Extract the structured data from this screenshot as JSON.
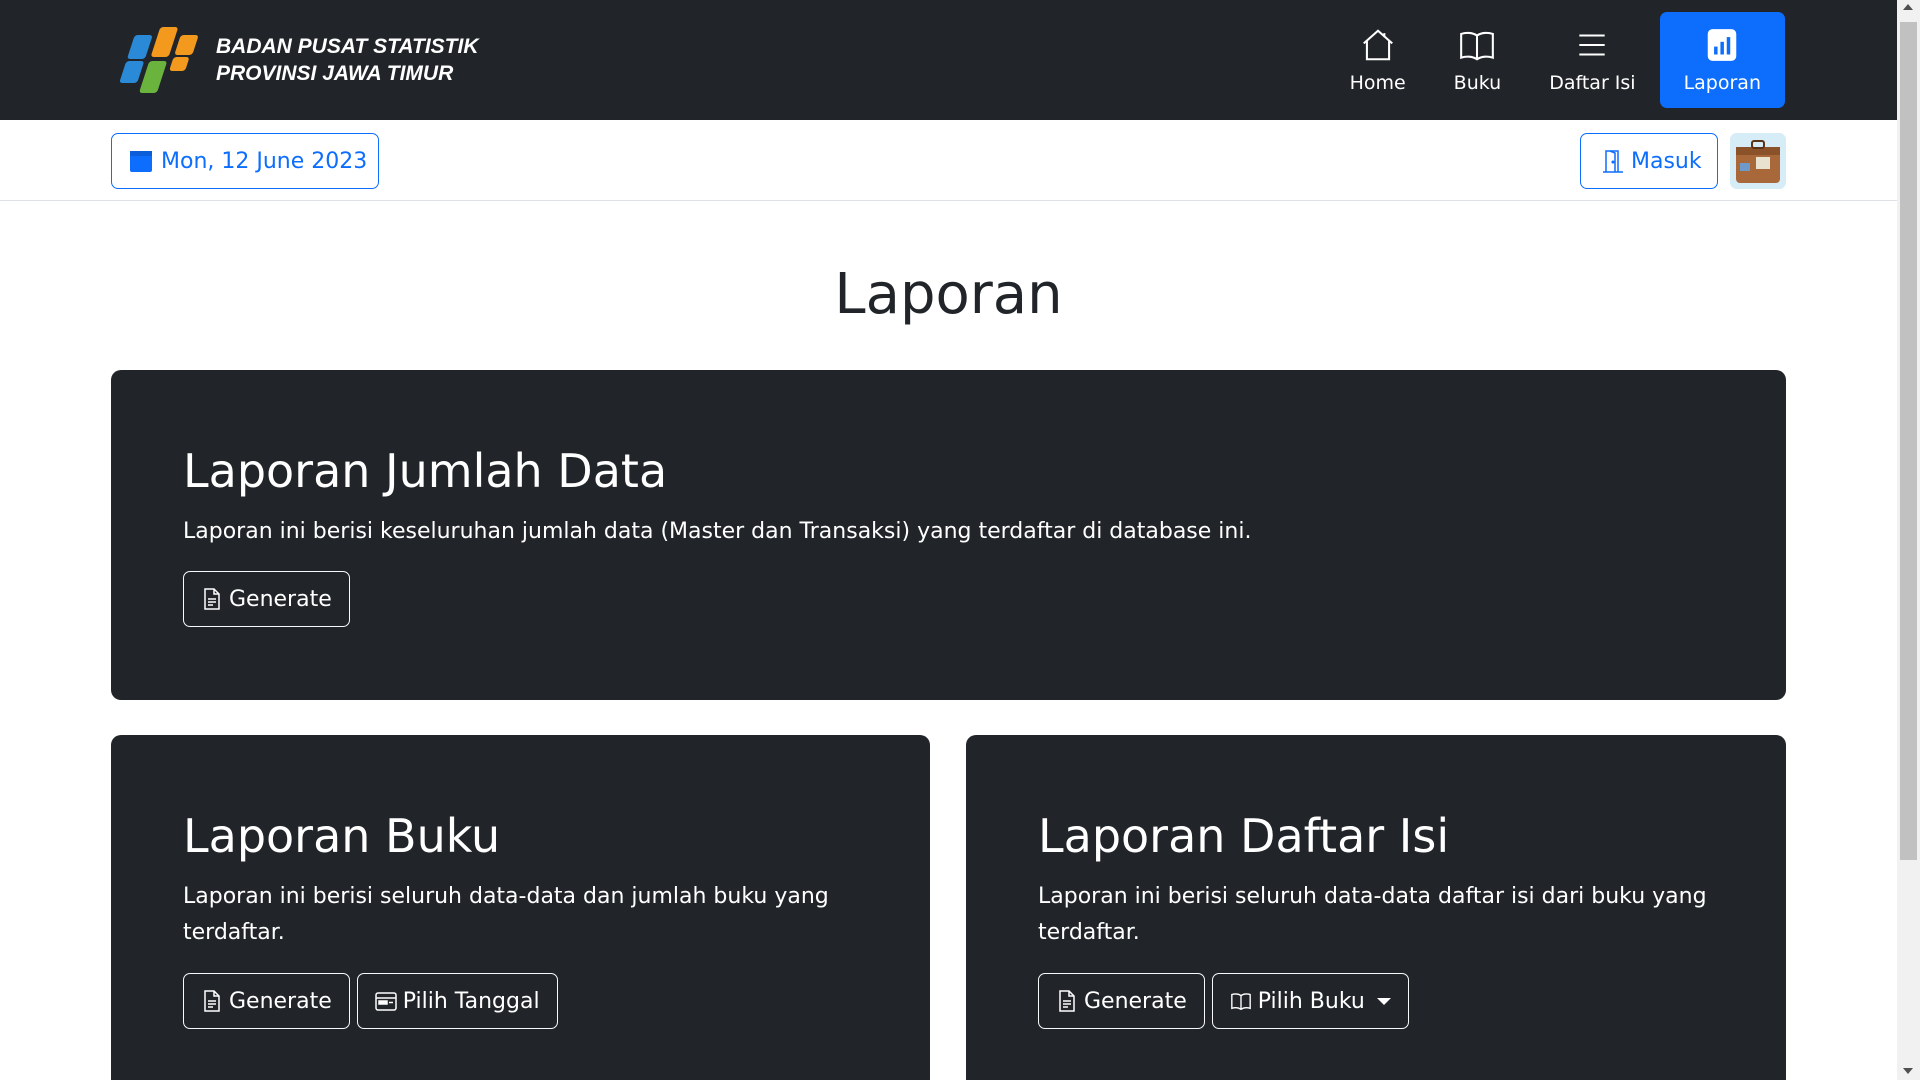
{
  "brand": {
    "line1": "BADAN PUSAT STATISTIK",
    "line2": "PROVINSI JAWA TIMUR",
    "logo_icon": "bps-logo-icon"
  },
  "nav": {
    "items": [
      {
        "label": "Home",
        "icon": "home-icon",
        "active": false
      },
      {
        "label": "Buku",
        "icon": "book-icon",
        "active": false
      },
      {
        "label": "Daftar Isi",
        "icon": "list-icon",
        "active": false
      },
      {
        "label": "Laporan",
        "icon": "bar-chart-icon",
        "active": true
      }
    ],
    "active_color": "#0d6efd"
  },
  "subbar": {
    "date_label": "Mon, 12 June 2023",
    "login_label": "Masuk"
  },
  "page": {
    "title": "Laporan"
  },
  "cards": {
    "jumlah_data": {
      "title": "Laporan Jumlah Data",
      "text": "Laporan ini berisi keseluruhan jumlah data (Master dan Transaksi) yang terdaftar di database ini.",
      "generate_label": "Generate"
    },
    "buku": {
      "title": "Laporan Buku",
      "text": "Laporan ini berisi seluruh data-data dan jumlah buku yang terdaftar.",
      "generate_label": "Generate",
      "date_label": "Pilih Tanggal"
    },
    "daftar_isi": {
      "title": "Laporan Daftar Isi",
      "text": "Laporan ini berisi seluruh data-data daftar isi dari buku yang terdaftar.",
      "generate_label": "Generate",
      "book_label": "Pilih Buku"
    }
  },
  "colors": {
    "navbar_bg": "#212529",
    "card_bg": "#212529",
    "primary": "#0d6efd"
  }
}
